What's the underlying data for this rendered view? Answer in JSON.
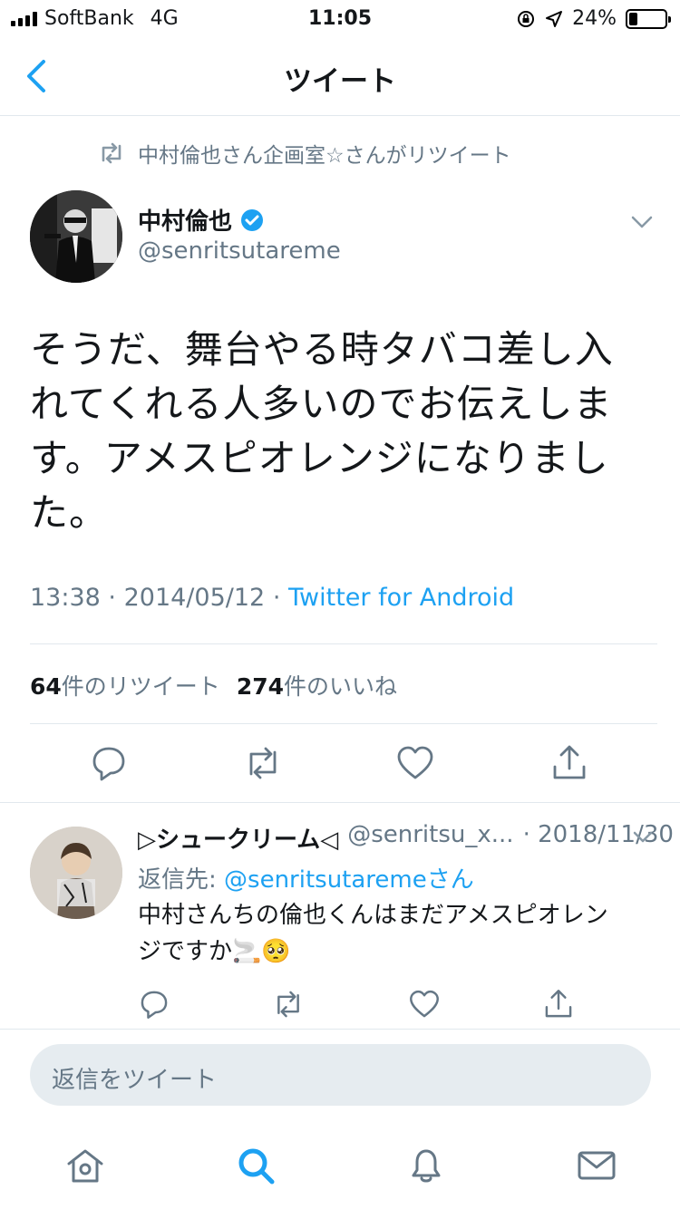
{
  "status_bar": {
    "carrier": "SoftBank",
    "network": "4G",
    "time": "11:05",
    "battery_percent": "24%",
    "battery_level": 0.24
  },
  "nav": {
    "title": "ツイート"
  },
  "retweet_context": {
    "text": "中村倫也さん企画室☆さんがリツイート"
  },
  "tweet": {
    "author_name": "中村倫也",
    "verified": true,
    "handle": "@senritsutareme",
    "lines": [
      "そうだ、舞台やる時タバコ差し入",
      "れてくれる人多いのでお伝えしま",
      "す。アメスピオレンジになりまし",
      "た。"
    ],
    "time": "13:38",
    "date": "2014/05/12",
    "source": "Twitter for Android",
    "separator": "·",
    "retweets_count": "64",
    "retweets_label": "件のリツイート",
    "likes_count": "274",
    "likes_label": "件のいいね"
  },
  "reply": {
    "name": "▷シュークリーム◁",
    "handle": "@senritsu_x...",
    "date": "· 2018/11/30",
    "reply_to_label": "返信先: ",
    "reply_to_mention": "@senritsutareme",
    "reply_to_suffix": "さん",
    "text_line1": "中村さんちの倫也くんはまだアメスピオレン",
    "text_line2": "ジですか🚬🥺"
  },
  "compose": {
    "placeholder": "返信をツイート"
  },
  "colors": {
    "accent": "#1da1f2",
    "secondary_text": "#657786",
    "divider": "#e1e8ed",
    "compose_bg": "#e6ecf0"
  },
  "icons": {
    "back": "chevron-left-icon",
    "more": "chevron-down-icon",
    "reply": "reply-icon",
    "retweet": "retweet-icon",
    "like": "heart-icon",
    "share": "share-icon",
    "home": "home-icon",
    "search": "search-icon",
    "notifications": "bell-icon",
    "messages": "mail-icon"
  }
}
